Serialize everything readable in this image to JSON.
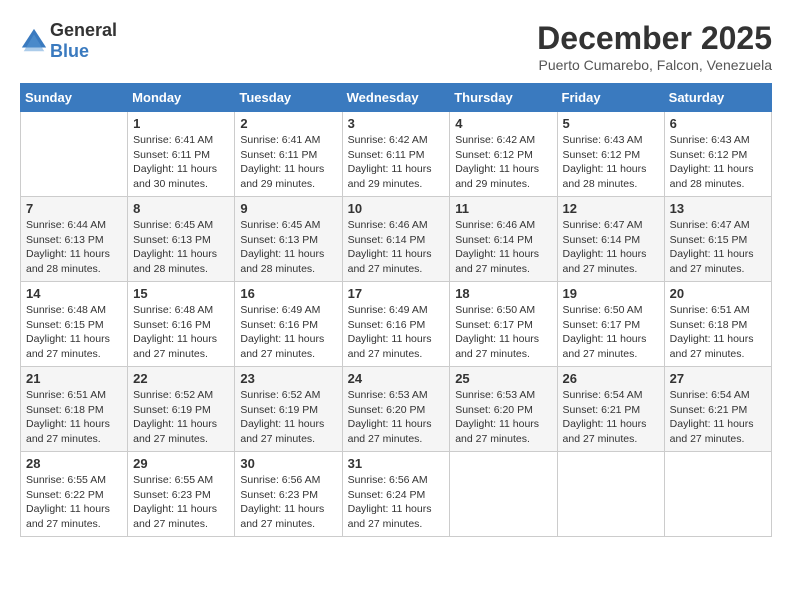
{
  "logo": {
    "general": "General",
    "blue": "Blue"
  },
  "header": {
    "title": "December 2025",
    "subtitle": "Puerto Cumarebo, Falcon, Venezuela"
  },
  "weekdays": [
    "Sunday",
    "Monday",
    "Tuesday",
    "Wednesday",
    "Thursday",
    "Friday",
    "Saturday"
  ],
  "weeks": [
    [
      {
        "day": "",
        "empty": true
      },
      {
        "day": "1",
        "sunrise": "Sunrise: 6:41 AM",
        "sunset": "Sunset: 6:11 PM",
        "daylight": "Daylight: 11 hours and 30 minutes."
      },
      {
        "day": "2",
        "sunrise": "Sunrise: 6:41 AM",
        "sunset": "Sunset: 6:11 PM",
        "daylight": "Daylight: 11 hours and 29 minutes."
      },
      {
        "day": "3",
        "sunrise": "Sunrise: 6:42 AM",
        "sunset": "Sunset: 6:11 PM",
        "daylight": "Daylight: 11 hours and 29 minutes."
      },
      {
        "day": "4",
        "sunrise": "Sunrise: 6:42 AM",
        "sunset": "Sunset: 6:12 PM",
        "daylight": "Daylight: 11 hours and 29 minutes."
      },
      {
        "day": "5",
        "sunrise": "Sunrise: 6:43 AM",
        "sunset": "Sunset: 6:12 PM",
        "daylight": "Daylight: 11 hours and 28 minutes."
      },
      {
        "day": "6",
        "sunrise": "Sunrise: 6:43 AM",
        "sunset": "Sunset: 6:12 PM",
        "daylight": "Daylight: 11 hours and 28 minutes."
      }
    ],
    [
      {
        "day": "7",
        "sunrise": "Sunrise: 6:44 AM",
        "sunset": "Sunset: 6:13 PM",
        "daylight": "Daylight: 11 hours and 28 minutes."
      },
      {
        "day": "8",
        "sunrise": "Sunrise: 6:45 AM",
        "sunset": "Sunset: 6:13 PM",
        "daylight": "Daylight: 11 hours and 28 minutes."
      },
      {
        "day": "9",
        "sunrise": "Sunrise: 6:45 AM",
        "sunset": "Sunset: 6:13 PM",
        "daylight": "Daylight: 11 hours and 28 minutes."
      },
      {
        "day": "10",
        "sunrise": "Sunrise: 6:46 AM",
        "sunset": "Sunset: 6:14 PM",
        "daylight": "Daylight: 11 hours and 27 minutes."
      },
      {
        "day": "11",
        "sunrise": "Sunrise: 6:46 AM",
        "sunset": "Sunset: 6:14 PM",
        "daylight": "Daylight: 11 hours and 27 minutes."
      },
      {
        "day": "12",
        "sunrise": "Sunrise: 6:47 AM",
        "sunset": "Sunset: 6:14 PM",
        "daylight": "Daylight: 11 hours and 27 minutes."
      },
      {
        "day": "13",
        "sunrise": "Sunrise: 6:47 AM",
        "sunset": "Sunset: 6:15 PM",
        "daylight": "Daylight: 11 hours and 27 minutes."
      }
    ],
    [
      {
        "day": "14",
        "sunrise": "Sunrise: 6:48 AM",
        "sunset": "Sunset: 6:15 PM",
        "daylight": "Daylight: 11 hours and 27 minutes."
      },
      {
        "day": "15",
        "sunrise": "Sunrise: 6:48 AM",
        "sunset": "Sunset: 6:16 PM",
        "daylight": "Daylight: 11 hours and 27 minutes."
      },
      {
        "day": "16",
        "sunrise": "Sunrise: 6:49 AM",
        "sunset": "Sunset: 6:16 PM",
        "daylight": "Daylight: 11 hours and 27 minutes."
      },
      {
        "day": "17",
        "sunrise": "Sunrise: 6:49 AM",
        "sunset": "Sunset: 6:16 PM",
        "daylight": "Daylight: 11 hours and 27 minutes."
      },
      {
        "day": "18",
        "sunrise": "Sunrise: 6:50 AM",
        "sunset": "Sunset: 6:17 PM",
        "daylight": "Daylight: 11 hours and 27 minutes."
      },
      {
        "day": "19",
        "sunrise": "Sunrise: 6:50 AM",
        "sunset": "Sunset: 6:17 PM",
        "daylight": "Daylight: 11 hours and 27 minutes."
      },
      {
        "day": "20",
        "sunrise": "Sunrise: 6:51 AM",
        "sunset": "Sunset: 6:18 PM",
        "daylight": "Daylight: 11 hours and 27 minutes."
      }
    ],
    [
      {
        "day": "21",
        "sunrise": "Sunrise: 6:51 AM",
        "sunset": "Sunset: 6:18 PM",
        "daylight": "Daylight: 11 hours and 27 minutes."
      },
      {
        "day": "22",
        "sunrise": "Sunrise: 6:52 AM",
        "sunset": "Sunset: 6:19 PM",
        "daylight": "Daylight: 11 hours and 27 minutes."
      },
      {
        "day": "23",
        "sunrise": "Sunrise: 6:52 AM",
        "sunset": "Sunset: 6:19 PM",
        "daylight": "Daylight: 11 hours and 27 minutes."
      },
      {
        "day": "24",
        "sunrise": "Sunrise: 6:53 AM",
        "sunset": "Sunset: 6:20 PM",
        "daylight": "Daylight: 11 hours and 27 minutes."
      },
      {
        "day": "25",
        "sunrise": "Sunrise: 6:53 AM",
        "sunset": "Sunset: 6:20 PM",
        "daylight": "Daylight: 11 hours and 27 minutes."
      },
      {
        "day": "26",
        "sunrise": "Sunrise: 6:54 AM",
        "sunset": "Sunset: 6:21 PM",
        "daylight": "Daylight: 11 hours and 27 minutes."
      },
      {
        "day": "27",
        "sunrise": "Sunrise: 6:54 AM",
        "sunset": "Sunset: 6:21 PM",
        "daylight": "Daylight: 11 hours and 27 minutes."
      }
    ],
    [
      {
        "day": "28",
        "sunrise": "Sunrise: 6:55 AM",
        "sunset": "Sunset: 6:22 PM",
        "daylight": "Daylight: 11 hours and 27 minutes."
      },
      {
        "day": "29",
        "sunrise": "Sunrise: 6:55 AM",
        "sunset": "Sunset: 6:23 PM",
        "daylight": "Daylight: 11 hours and 27 minutes."
      },
      {
        "day": "30",
        "sunrise": "Sunrise: 6:56 AM",
        "sunset": "Sunset: 6:23 PM",
        "daylight": "Daylight: 11 hours and 27 minutes."
      },
      {
        "day": "31",
        "sunrise": "Sunrise: 6:56 AM",
        "sunset": "Sunset: 6:24 PM",
        "daylight": "Daylight: 11 hours and 27 minutes."
      },
      {
        "day": "",
        "empty": true
      },
      {
        "day": "",
        "empty": true
      },
      {
        "day": "",
        "empty": true
      }
    ]
  ]
}
